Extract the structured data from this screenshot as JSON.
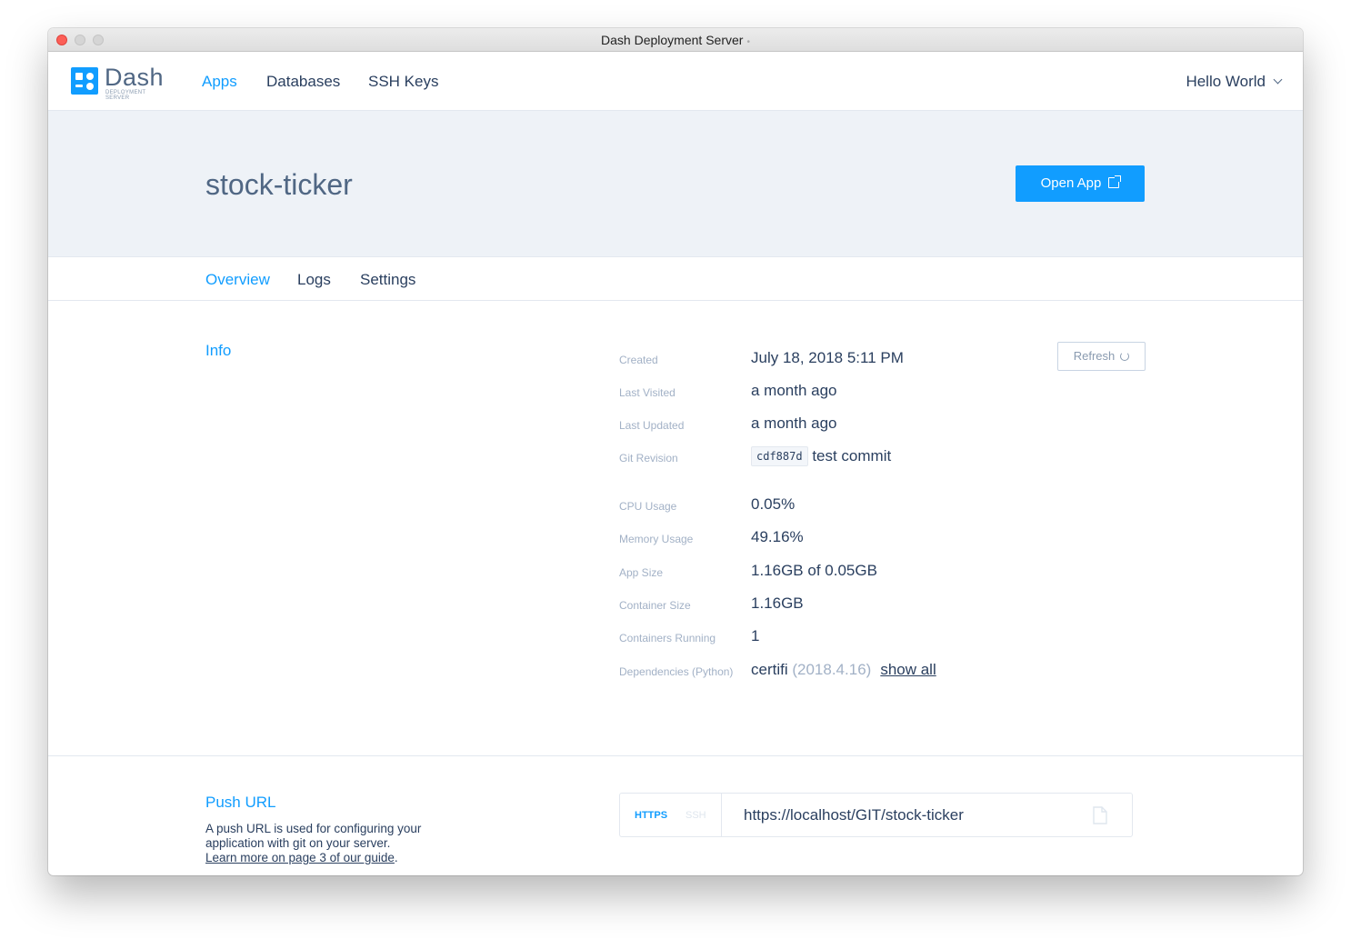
{
  "window": {
    "title": "Dash Deployment Server",
    "title_dot": "•"
  },
  "brand": {
    "name": "Dash",
    "subtitle": "DEPLOYMENT SERVER",
    "color": "#119dff"
  },
  "topnav": {
    "items": [
      {
        "label": "Apps",
        "active": true
      },
      {
        "label": "Databases",
        "active": false
      },
      {
        "label": "SSH Keys",
        "active": false
      }
    ],
    "user": "Hello World",
    "user_icon": "chevron-down-icon"
  },
  "app": {
    "name": "stock-ticker",
    "open_button": "Open App",
    "open_icon": "external-link-icon"
  },
  "tabs": [
    {
      "label": "Overview",
      "active": true
    },
    {
      "label": "Logs",
      "active": false
    },
    {
      "label": "Settings",
      "active": false
    }
  ],
  "info": {
    "title": "Info",
    "refresh_label": "Refresh",
    "refresh_icon": "refresh-icon",
    "created": {
      "label": "Created",
      "value": "July 18, 2018 5:11 PM"
    },
    "last_visited": {
      "label": "Last Visited",
      "value": "a month ago"
    },
    "last_updated": {
      "label": "Last Updated",
      "value": "a month ago"
    },
    "git_revision": {
      "label": "Git Revision",
      "hash": "cdf887d",
      "message": "test commit"
    },
    "cpu_usage": {
      "label": "CPU Usage",
      "value": "0.05%"
    },
    "memory_usage": {
      "label": "Memory Usage",
      "value": "49.16%"
    },
    "app_size": {
      "label": "App Size",
      "value": "1.16GB of 0.05GB"
    },
    "container_size": {
      "label": "Container Size",
      "value": "1.16GB"
    },
    "containers_running": {
      "label": "Containers Running",
      "value": "1"
    },
    "dependencies": {
      "label": "Dependencies (Python)",
      "name": "certifi",
      "version": "(2018.4.16)",
      "show_all": "show all"
    }
  },
  "push": {
    "title": "Push URL",
    "description": "A push URL is used for configuring your application with git on your server.",
    "link": "Learn more on page 3 of our guide",
    "link_suffix": ".",
    "protocols": [
      "HTTPS",
      "SSH"
    ],
    "active_protocol": "HTTPS",
    "url": "https://localhost/GIT/stock-ticker",
    "copy_icon": "copy-icon"
  }
}
